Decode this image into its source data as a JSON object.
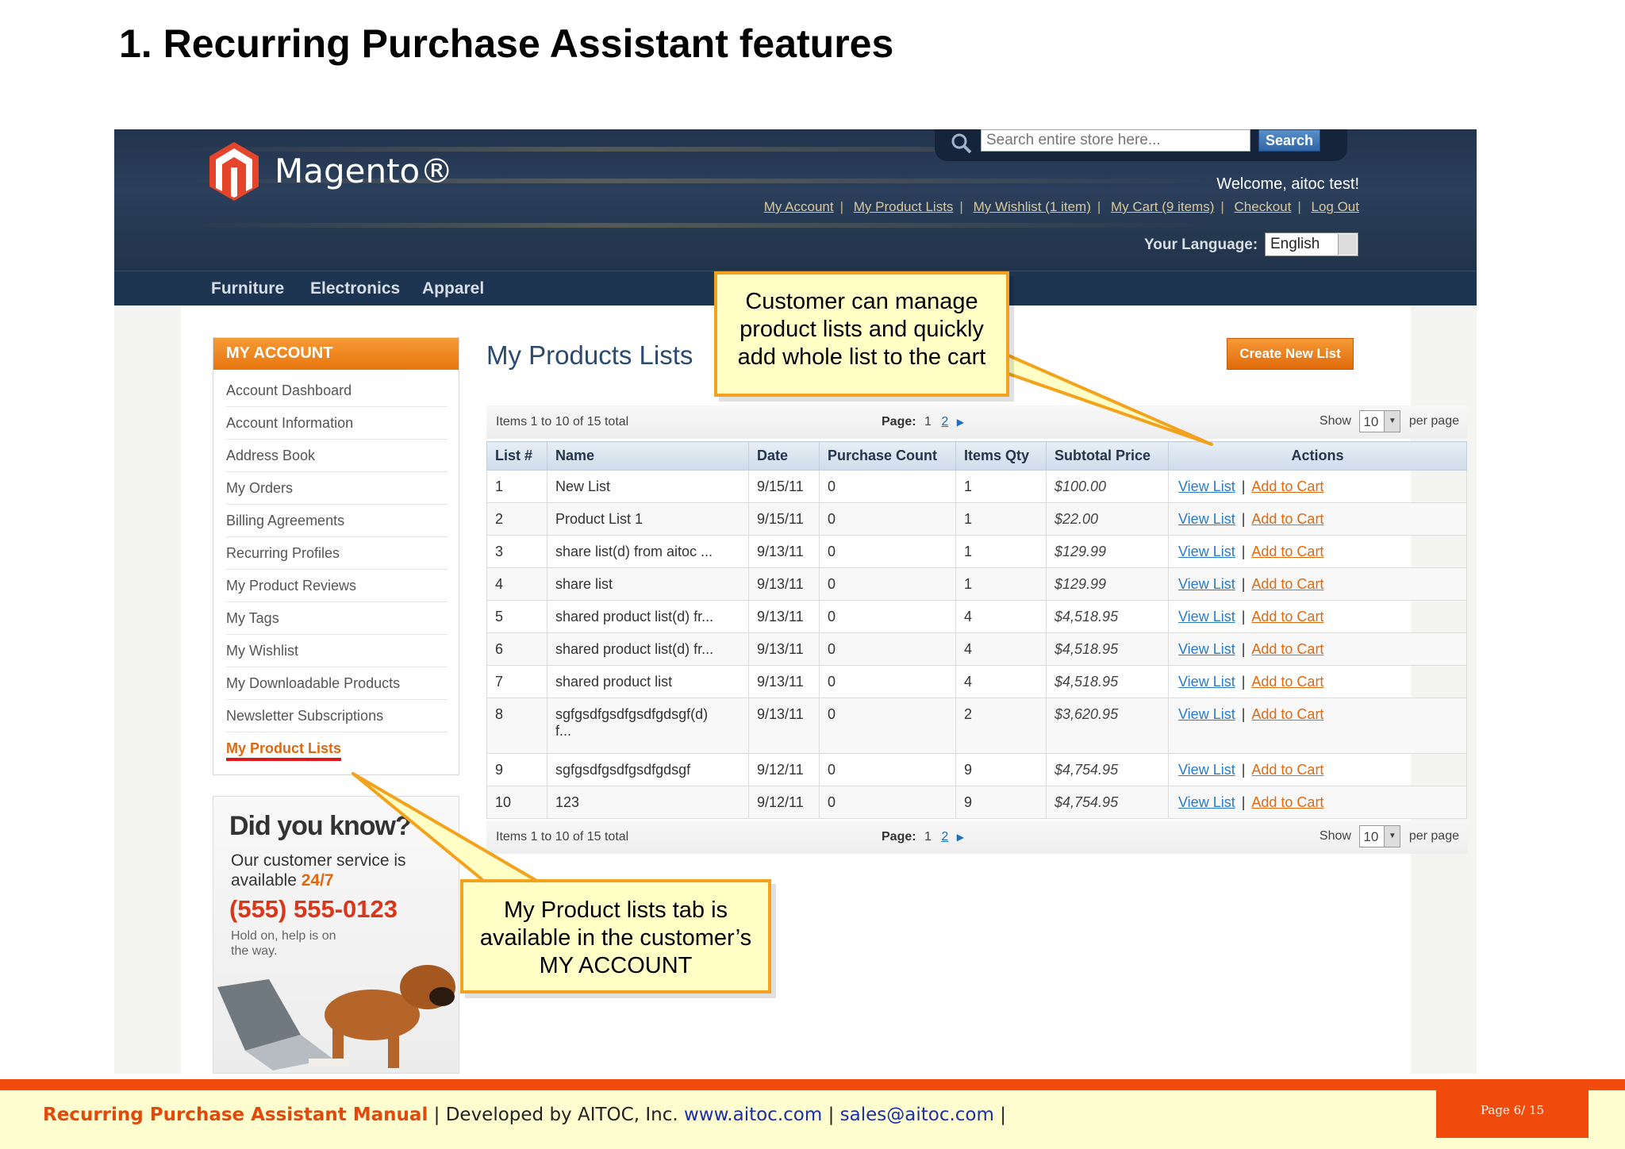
{
  "slide": {
    "title": "1. Recurring Purchase Assistant features"
  },
  "store": {
    "logo_text": "Magento®",
    "search": {
      "placeholder": "Search entire store here...",
      "button": "Search"
    },
    "welcome": "Welcome, aitoc test!",
    "top_links": [
      "My Account",
      "My Product Lists",
      "My Wishlist (1 item)",
      "My Cart (9 items)",
      "Checkout",
      "Log Out"
    ],
    "language": {
      "label": "Your Language:",
      "value": "English"
    },
    "nav": [
      "Furniture",
      "Electronics",
      "Apparel"
    ]
  },
  "account": {
    "heading": "MY ACCOUNT",
    "items": [
      "Account Dashboard",
      "Account Information",
      "Address Book",
      "My Orders",
      "Billing Agreements",
      "Recurring Profiles",
      "My Product Reviews",
      "My Tags",
      "My Wishlist",
      "My Downloadable Products",
      "Newsletter Subscriptions",
      "My Product Lists"
    ],
    "active_item": "My Product Lists"
  },
  "promo": {
    "title": "Did you know?",
    "line1": "Our customer service is",
    "line2": "available ",
    "highlight": "24/7",
    "phone": "(555) 555-0123",
    "note": "Hold on, help is on the way."
  },
  "main": {
    "title": "My Products Lists",
    "create_button": "Create New List",
    "pager_top": {
      "count": "Items 1 to 10 of 15 total",
      "page_label": "Page:",
      "current_page": "1",
      "next_page": "2",
      "show_label": "Show",
      "show_value": "10",
      "per_page": "per page"
    },
    "pager_bottom": {
      "count": "Items 1 to 10 of 15 total",
      "page_label": "Page:",
      "current_page": "1",
      "next_page": "2",
      "show_label": "Show",
      "show_value": "10",
      "per_page": "per page"
    },
    "columns": [
      "List #",
      "Name",
      "Date",
      "Purchase Count",
      "Items Qty",
      "Subtotal Price",
      "Actions"
    ],
    "view_label": "View List",
    "cart_label": "Add to Cart",
    "rows": [
      {
        "n": "1",
        "name": "New List",
        "date": "9/15/11",
        "pc": "0",
        "qty": "1",
        "price": "$100.00"
      },
      {
        "n": "2",
        "name": "Product List 1",
        "date": "9/15/11",
        "pc": "0",
        "qty": "1",
        "price": "$22.00"
      },
      {
        "n": "3",
        "name": "share list(d) from aitoc ...",
        "date": "9/13/11",
        "pc": "0",
        "qty": "1",
        "price": "$129.99"
      },
      {
        "n": "4",
        "name": "share list",
        "date": "9/13/11",
        "pc": "0",
        "qty": "1",
        "price": "$129.99"
      },
      {
        "n": "5",
        "name": "shared product list(d) fr...",
        "date": "9/13/11",
        "pc": "0",
        "qty": "4",
        "price": "$4,518.95"
      },
      {
        "n": "6",
        "name": "shared product list(d) fr...",
        "date": "9/13/11",
        "pc": "0",
        "qty": "4",
        "price": "$4,518.95"
      },
      {
        "n": "7",
        "name": "shared product list",
        "date": "9/13/11",
        "pc": "0",
        "qty": "4",
        "price": "$4,518.95"
      },
      {
        "n": "8",
        "name": "sgfgsdfgsdfgsdfgdsgf(d)",
        "name2": "f...",
        "date": "9/13/11",
        "pc": "0",
        "qty": "2",
        "price": "$3,620.95"
      },
      {
        "n": "9",
        "name": "sgfgsdfgsdfgsdfgdsgf",
        "date": "9/12/11",
        "pc": "0",
        "qty": "9",
        "price": "$4,754.95"
      },
      {
        "n": "10",
        "name": "123",
        "date": "9/12/11",
        "pc": "0",
        "qty": "9",
        "price": "$4,754.95"
      }
    ]
  },
  "callouts": {
    "top": [
      "Customer can manage",
      "product lists and quickly",
      "add whole list to the cart"
    ],
    "bottom": [
      "My Product lists tab is",
      "available in the customer’s",
      "MY ACCOUNT"
    ]
  },
  "footer": {
    "brand": "Recurring Purchase Assistant Manual",
    "developer": " | Developed by AITOC, Inc. ",
    "site": "www.aitoc.com",
    "sep": " | ",
    "email": "sales@aitoc.com",
    "end": " |",
    "page": "Page 6/ 15"
  },
  "colors": {
    "accent_orange": "#e9760e",
    "callout_fill": "#ffffc6",
    "callout_border": "#f2a21c",
    "header_navy": "#22344d",
    "footer_red": "#f04b0d"
  }
}
